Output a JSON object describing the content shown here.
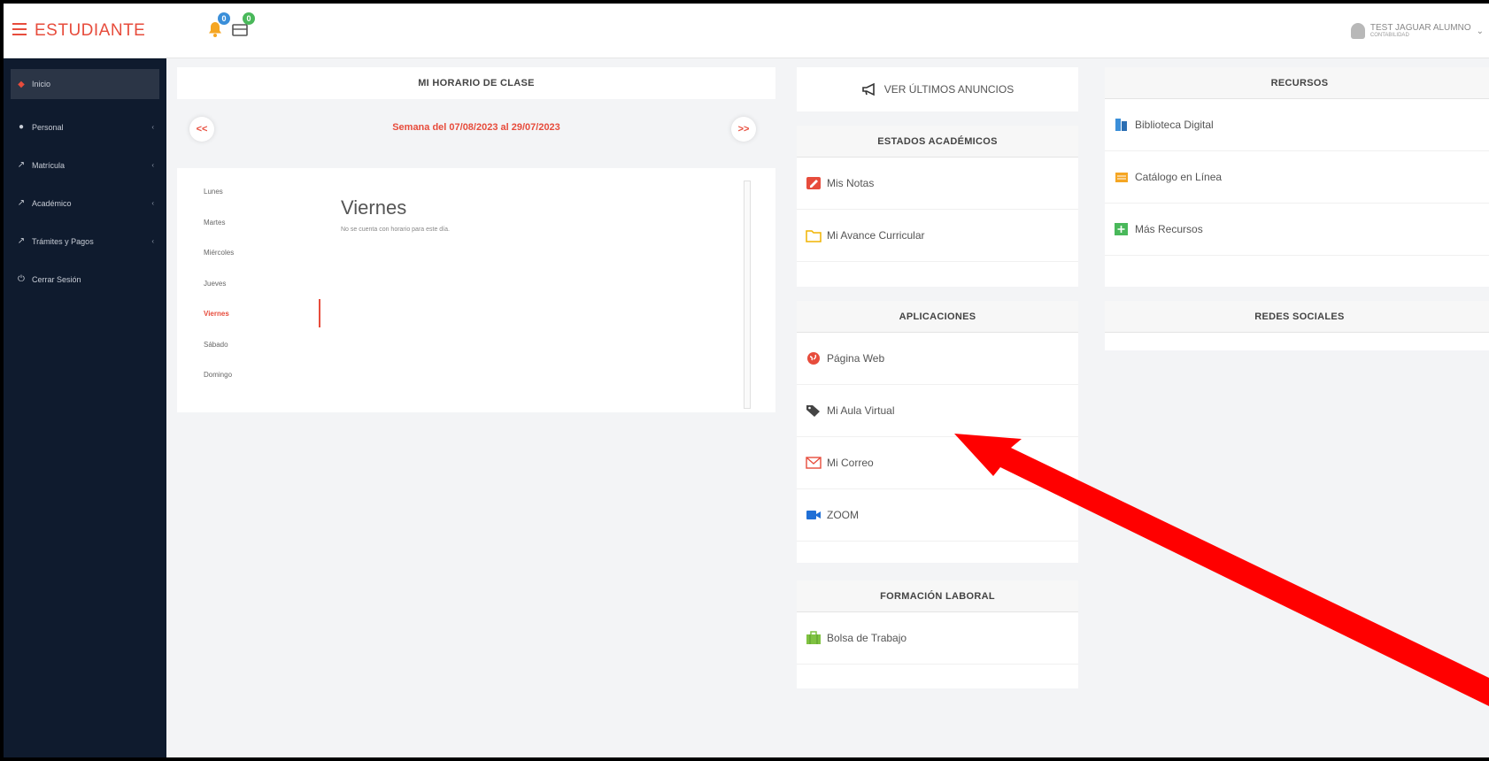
{
  "app": {
    "brand": "ESTUDIANTE",
    "notification_count": "0",
    "message_count": "0",
    "user_name": "TEST JAGUAR ALUMNO",
    "user_sub": "CONTABILIDAD"
  },
  "sidebar": {
    "items": [
      {
        "label": "Inicio",
        "icon": "home-icon"
      },
      {
        "label": "Personal",
        "icon": "user-icon"
      },
      {
        "label": "Matrícula",
        "icon": "external-link-icon"
      },
      {
        "label": "Académico",
        "icon": "external-link-icon"
      },
      {
        "label": "Trámites y Pagos",
        "icon": "external-link-icon"
      },
      {
        "label": "Cerrar Sesión",
        "icon": "power-icon"
      }
    ]
  },
  "schedule": {
    "title": "MI HORARIO DE CLASE",
    "prev_label": "<<",
    "next_label": ">>",
    "week_label": "Semana del 07/08/2023 al 29/07/2023",
    "days": [
      "Lunes",
      "Martes",
      "Miércoles",
      "Jueves",
      "Viernes",
      "Sábado",
      "Domingo"
    ],
    "selected_day": "Viernes",
    "empty_message": "No se cuenta con horario para este día."
  },
  "announcements": {
    "label": "VER ÚLTIMOS ANUNCIOS"
  },
  "academic": {
    "title": "ESTADOS ACADÉMICOS",
    "items": [
      {
        "label": "Mis Notas",
        "icon": "edit-icon"
      },
      {
        "label": "Mi Avance Curricular",
        "icon": "folder-icon"
      }
    ]
  },
  "apps": {
    "title": "APLICACIONES",
    "items": [
      {
        "label": "Página Web",
        "icon": "globe-icon"
      },
      {
        "label": "Mi Aula Virtual",
        "icon": "tags-icon"
      },
      {
        "label": "Mi Correo",
        "icon": "mail-icon"
      },
      {
        "label": "ZOOM",
        "icon": "video-camera-icon"
      }
    ]
  },
  "work": {
    "title": "FORMACIÓN LABORAL",
    "items": [
      {
        "label": "Bolsa de Trabajo",
        "icon": "briefcase-icon"
      }
    ]
  },
  "resources": {
    "title": "RECURSOS",
    "items": [
      {
        "label": "Biblioteca Digital",
        "icon": "books-icon"
      },
      {
        "label": "Catálogo en Línea",
        "icon": "notebook-icon"
      },
      {
        "label": "Más Recursos",
        "icon": "plus-box-icon"
      }
    ]
  },
  "social": {
    "title": "REDES SOCIALES"
  },
  "colors": {
    "accent": "#e74c3c",
    "sidebar": "#0f1b2e",
    "annotation_arrow": "#ff0000"
  }
}
